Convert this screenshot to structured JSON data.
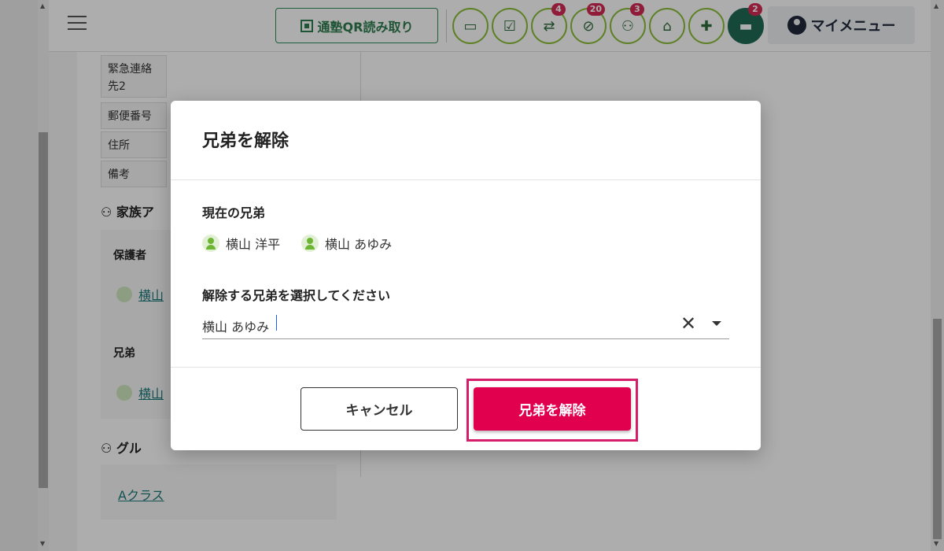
{
  "header": {
    "qr_button": "通塾QR読み取り",
    "badges": {
      "transfer": "4",
      "absence": "20",
      "members": "3",
      "messages": "2"
    },
    "my_menu": "マイメニュー"
  },
  "background": {
    "emergency_contact": "緊急連絡先2",
    "postal_code": "郵便番号",
    "address": "住所",
    "notes": "備考",
    "family_account": "家族ア",
    "guardian": "保護者",
    "guardian_link": "横山",
    "siblings": "兄弟",
    "sibling_link": "横山",
    "group": "グル",
    "class_link": "Aクラス"
  },
  "modal": {
    "title": "兄弟を解除",
    "current_label": "現在の兄弟",
    "current_siblings": [
      "横山 洋平",
      "横山 あゆみ"
    ],
    "select_label": "解除する兄弟を選択してください",
    "selected_value": "横山 あゆみ",
    "cancel_label": "キャンセル",
    "confirm_label": "兄弟を解除"
  },
  "colors": {
    "accent": "#e0004d",
    "highlight": "#d61d6a",
    "primary_green": "#2e7d4f"
  }
}
